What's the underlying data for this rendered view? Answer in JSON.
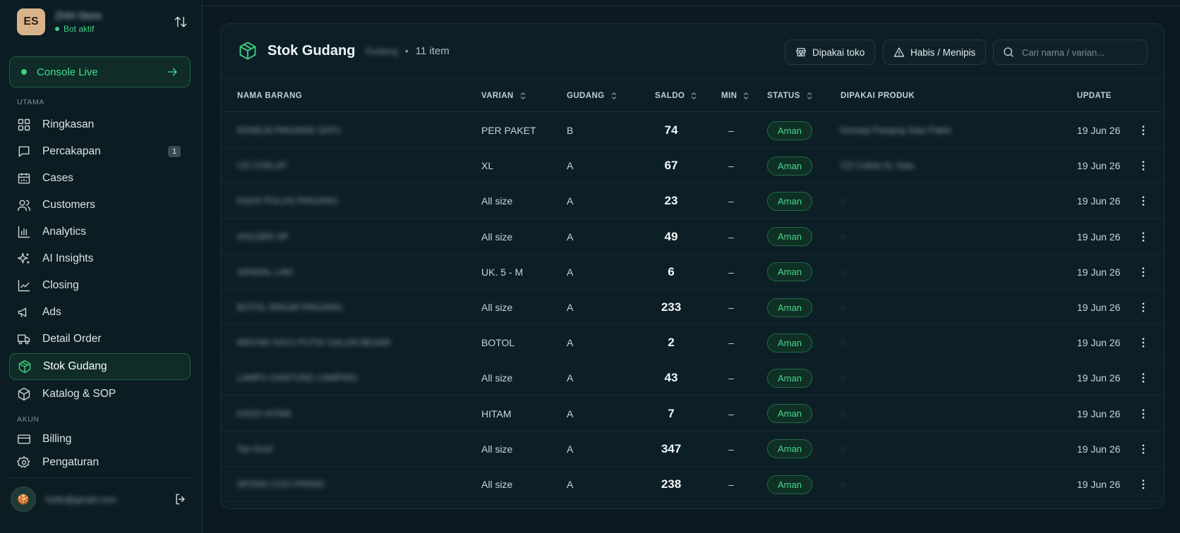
{
  "workspace": {
    "initials": "ES",
    "name": "ZHH Store",
    "status": "Bot aktif"
  },
  "console_live": {
    "label": "Console Live"
  },
  "sidebar": {
    "section_main": "UTAMA",
    "section_account": "AKUN",
    "items": [
      {
        "label": "Ringkasan",
        "icon": "grid-icon"
      },
      {
        "label": "Percakapan",
        "icon": "chat-icon",
        "badge": "1"
      },
      {
        "label": "Cases",
        "icon": "calendar-icon"
      },
      {
        "label": "Customers",
        "icon": "users-icon"
      },
      {
        "label": "Analytics",
        "icon": "bar-chart-icon"
      },
      {
        "label": "AI Insights",
        "icon": "sparkle-icon"
      },
      {
        "label": "Closing",
        "icon": "line-chart-icon"
      },
      {
        "label": "Ads",
        "icon": "megaphone-icon"
      },
      {
        "label": "Detail Order",
        "icon": "truck-icon"
      },
      {
        "label": "Stok Gudang",
        "icon": "box-icon",
        "active": true
      },
      {
        "label": "Katalog & SOP",
        "icon": "cube-icon"
      }
    ],
    "account_items": [
      {
        "label": "Billing",
        "icon": "card-icon"
      },
      {
        "label": "Pengaturan",
        "icon": "gear-icon"
      }
    ],
    "user": {
      "email": "hello@gmail.com"
    }
  },
  "main": {
    "title": "Stok Gudang",
    "subtitle": "Gudang",
    "count": "11 item",
    "filter_store": "Dipakai toko",
    "filter_low": "Habis / Menipis",
    "search_placeholder": "Cari nama / varian...",
    "columns": {
      "name": "NAMA BARANG",
      "variant": "VARIAN",
      "warehouse": "GUDANG",
      "balance": "SALDO",
      "min": "MIN",
      "status": "STATUS",
      "used_in": "DIPAKAI PRODUK",
      "update": "UPDATE"
    },
    "rows": [
      {
        "name": "KEMEJA PANJANG SATU",
        "variant": "PER PAKET",
        "warehouse": "B",
        "balance": "74",
        "min": "–",
        "status": "Aman",
        "used_in": "Kemeja Panjang Satu Paket",
        "update": "19 Jun 26"
      },
      {
        "name": "CD COKLAT",
        "variant": "XL",
        "warehouse": "A",
        "balance": "67",
        "min": "–",
        "status": "Aman",
        "used_in": "CD Coklat XL Satu",
        "update": "19 Jun 26"
      },
      {
        "name": "KAOS POLOS PANJANG",
        "variant": "All size",
        "warehouse": "A",
        "balance": "23",
        "min": "–",
        "status": "Aman",
        "used_in": "–",
        "update": "19 Jun 26"
      },
      {
        "name": "HOLDER HP",
        "variant": "All size",
        "warehouse": "A",
        "balance": "49",
        "min": "–",
        "status": "Aman",
        "used_in": "–",
        "update": "19 Jun 26"
      },
      {
        "name": "SANDAL LAKI",
        "variant": "UK. 5 - M",
        "warehouse": "A",
        "balance": "6",
        "min": "–",
        "status": "Aman",
        "used_in": "–",
        "update": "19 Jun 26"
      },
      {
        "name": "BOTOL MINUM PANJANG",
        "variant": "All size",
        "warehouse": "A",
        "balance": "233",
        "min": "–",
        "status": "Aman",
        "used_in": "–",
        "update": "19 Jun 26"
      },
      {
        "name": "MINYAK KAYU PUTIH GALON BESAR",
        "variant": "BOTOL",
        "warehouse": "A",
        "balance": "2",
        "min": "–",
        "status": "Aman",
        "used_in": "–",
        "update": "19 Jun 26"
      },
      {
        "name": "LAMPU GANTUNG CAMPING",
        "variant": "All size",
        "warehouse": "A",
        "balance": "43",
        "min": "–",
        "status": "Aman",
        "used_in": "–",
        "update": "19 Jun 26"
      },
      {
        "name": "KAOS HITAM",
        "variant": "HITAM",
        "warehouse": "A",
        "balance": "7",
        "min": "–",
        "status": "Aman",
        "used_in": "–",
        "update": "19 Jun 26"
      },
      {
        "name": "Tas Kecil",
        "variant": "All size",
        "warehouse": "A",
        "balance": "347",
        "min": "–",
        "status": "Aman",
        "used_in": "–",
        "update": "19 Jun 26"
      },
      {
        "name": "SPONS CUCI PIRING",
        "variant": "All size",
        "warehouse": "A",
        "balance": "238",
        "min": "–",
        "status": "Aman",
        "used_in": "–",
        "update": "19 Jun 26"
      }
    ]
  },
  "colors": {
    "accent": "#3fcf82",
    "background": "#0a1a20",
    "card": "#0d1f26"
  }
}
